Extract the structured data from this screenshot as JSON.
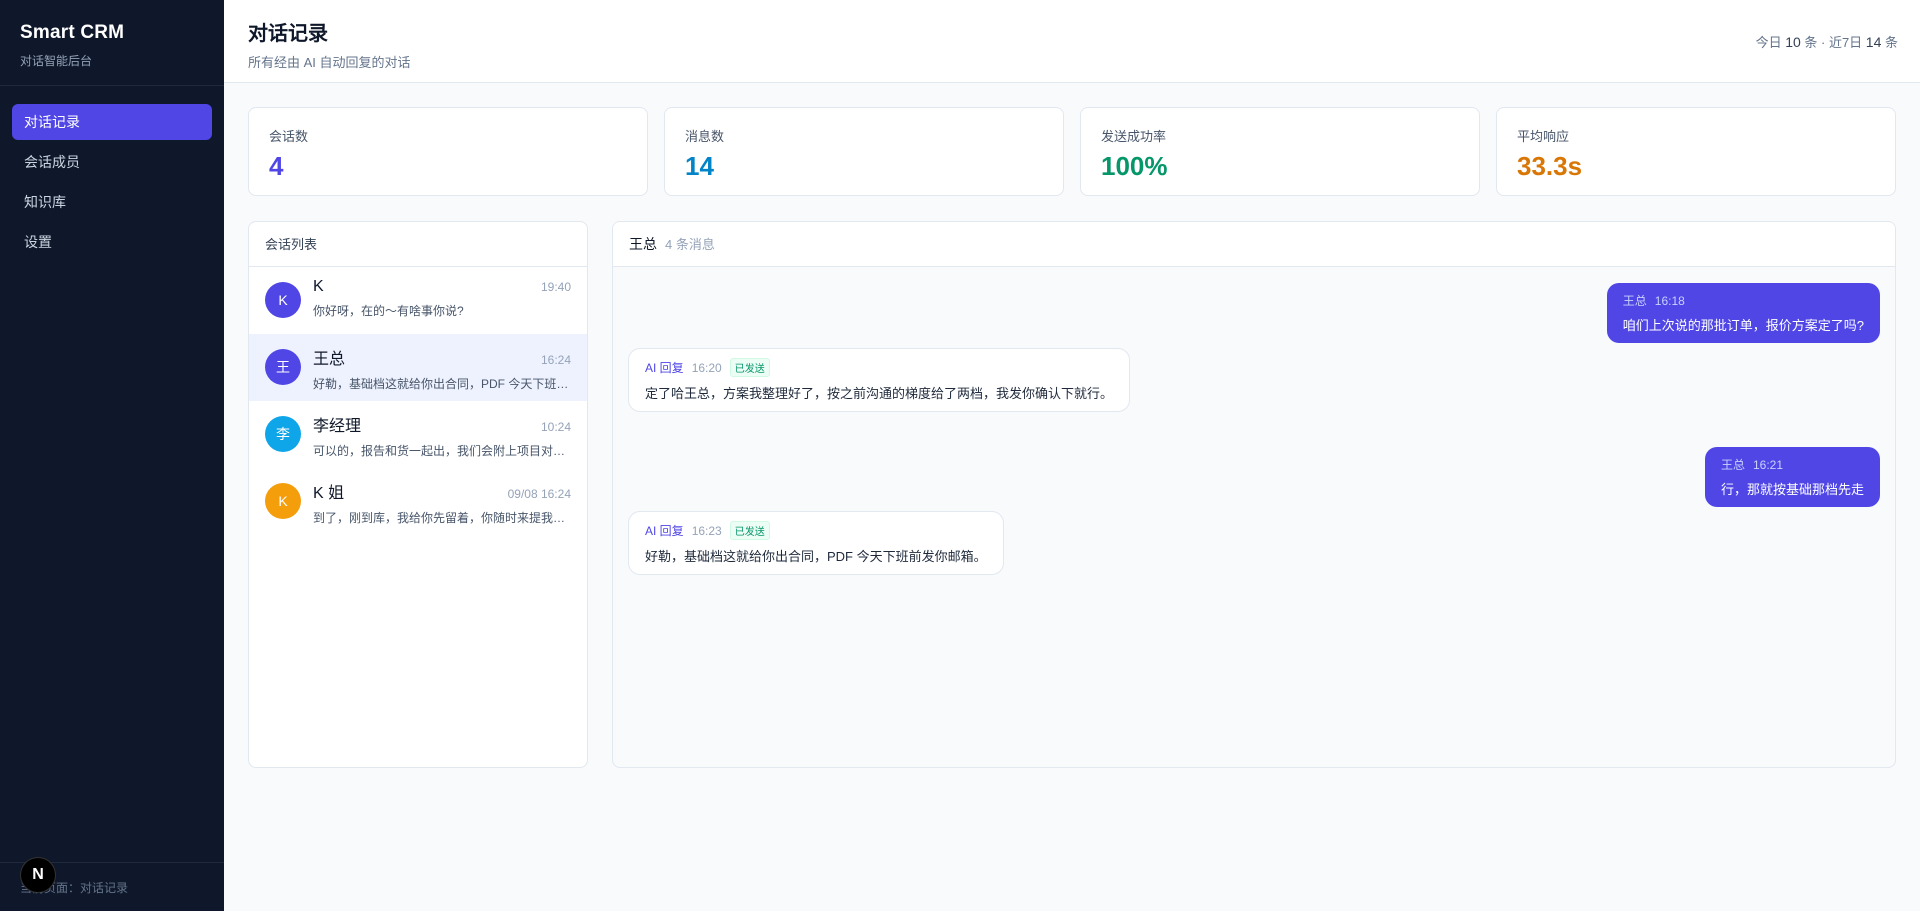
{
  "sidebar": {
    "brand_title": "Smart CRM",
    "brand_sub": "对话智能后台",
    "items": [
      {
        "label": "对话记录",
        "active": true
      },
      {
        "label": "会话成员",
        "active": false
      },
      {
        "label": "知识库",
        "active": false
      },
      {
        "label": "设置",
        "active": false
      }
    ],
    "footer": "当前页面：对话记录",
    "badge_letter": "N"
  },
  "header": {
    "title": "对话记录",
    "subtitle": "所有经由 AI 自动回复的对话",
    "stats_prefix_today": "今日 ",
    "today_count": "10",
    "stats_mid": " 条 · 近7日 ",
    "week_count": "14",
    "stats_suffix": " 条"
  },
  "stats": [
    {
      "label": "会话数",
      "value": "4",
      "color": "#4f46e5"
    },
    {
      "label": "消息数",
      "value": "14",
      "color": "#0284c7"
    },
    {
      "label": "发送成功率",
      "value": "100%",
      "color": "#059669"
    },
    {
      "label": "平均响应",
      "value": "33.3s",
      "color": "#d97706"
    }
  ],
  "conversations": {
    "title": "会话列表",
    "items": [
      {
        "avatar": "K",
        "avatar_color": "#4f46e5",
        "name": "K",
        "time": "19:40",
        "preview": "你好呀，在的～有啥事你说?"
      },
      {
        "avatar": "王",
        "avatar_color": "#4f46e5",
        "name": "王总",
        "time": "16:24",
        "preview": "好勒，基础档这就给你出合同，PDF 今天下班前发你邮箱。"
      },
      {
        "avatar": "李",
        "avatar_color": "#0ea5e9",
        "name": "李经理",
        "time": "10:24",
        "preview": "可以的，报告和货一起出，我们会附上项目对接人的联系方式。"
      },
      {
        "avatar": "K",
        "avatar_color": "#f59e0b",
        "name": "K 姐",
        "time": "09/08 16:24",
        "preview": "到了，刚到库，我给你先留着，你随时来提我这边都在。"
      }
    ]
  },
  "chat": {
    "name": "王总",
    "count": "4 条消息",
    "messages": [
      {
        "sender": "王总",
        "time": "16:18",
        "text": "咱们上次说的那批订单，报价方案定了吗?"
      },
      {
        "sender": "AI 回复",
        "time": "16:20",
        "status": "已发送",
        "text": "定了哈王总，方案我整理好了，按之前沟通的梯度给了两档，我发你确认下就行。"
      },
      {
        "sender": "王总",
        "time": "16:21",
        "text": "行，那就按基础那档先走"
      },
      {
        "sender": "AI 回复",
        "time": "16:23",
        "status": "已发送",
        "text": "好勒，基础档这就给你出合同，PDF 今天下班前发你邮箱。"
      }
    ]
  }
}
